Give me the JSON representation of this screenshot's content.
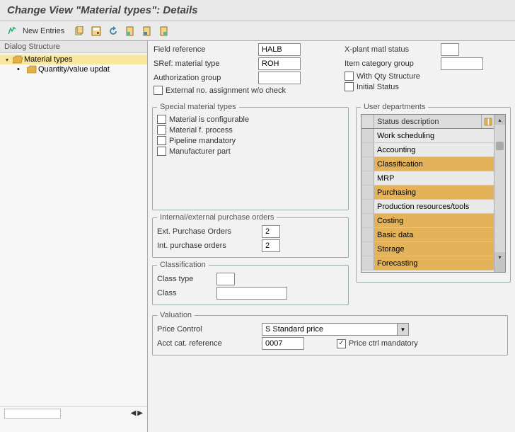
{
  "title": "Change View \"Material types\": Details",
  "toolbar": {
    "new_entries": "New Entries"
  },
  "sidebar": {
    "header": "Dialog Structure",
    "items": [
      {
        "label": "Material types",
        "selected": true
      },
      {
        "label": "Quantity/value updat",
        "selected": false
      }
    ]
  },
  "upper": {
    "left": {
      "field_reference_label": "Field reference",
      "field_reference_value": "HALB",
      "sref_label": "SRef: material type",
      "sref_value": "ROH",
      "auth_group_label": "Authorization group",
      "auth_group_value": "",
      "ext_no_label": "External no. assignment w/o check"
    },
    "right": {
      "xplant_label": "X-plant matl status",
      "xplant_value": "",
      "itemcat_label": "Item category group",
      "itemcat_value": "",
      "qty_label": "With Qty Structure",
      "initial_label": "Initial Status"
    }
  },
  "special": {
    "legend": "Special material types",
    "configurable": "Material is configurable",
    "process": "Material f. process",
    "pipeline": "Pipeline mandatory",
    "manufacturer": "Manufacturer part"
  },
  "user_depts": {
    "legend": "User departments",
    "header": "Status description",
    "rows": [
      {
        "label": "Work scheduling",
        "selected": false
      },
      {
        "label": "Accounting",
        "selected": false
      },
      {
        "label": "Classification",
        "selected": true
      },
      {
        "label": "MRP",
        "selected": false
      },
      {
        "label": "Purchasing",
        "selected": true
      },
      {
        "label": "Production resources/tools",
        "selected": false
      },
      {
        "label": "Costing",
        "selected": true
      },
      {
        "label": "Basic data",
        "selected": true
      },
      {
        "label": "Storage",
        "selected": true
      },
      {
        "label": "Forecasting",
        "selected": true
      }
    ]
  },
  "po": {
    "legend": "Internal/external purchase orders",
    "ext_label": "Ext. Purchase Orders",
    "ext_value": "2",
    "int_label": "Int. purchase orders",
    "int_value": "2"
  },
  "classification": {
    "legend": "Classification",
    "class_type_label": "Class type",
    "class_type_value": "",
    "class_label": "Class",
    "class_value": ""
  },
  "valuation": {
    "legend": "Valuation",
    "price_control_label": "Price Control",
    "price_control_value": "S Standard price",
    "acct_ref_label": "Acct cat. reference",
    "acct_ref_value": "0007",
    "price_mand_label": "Price ctrl mandatory"
  }
}
